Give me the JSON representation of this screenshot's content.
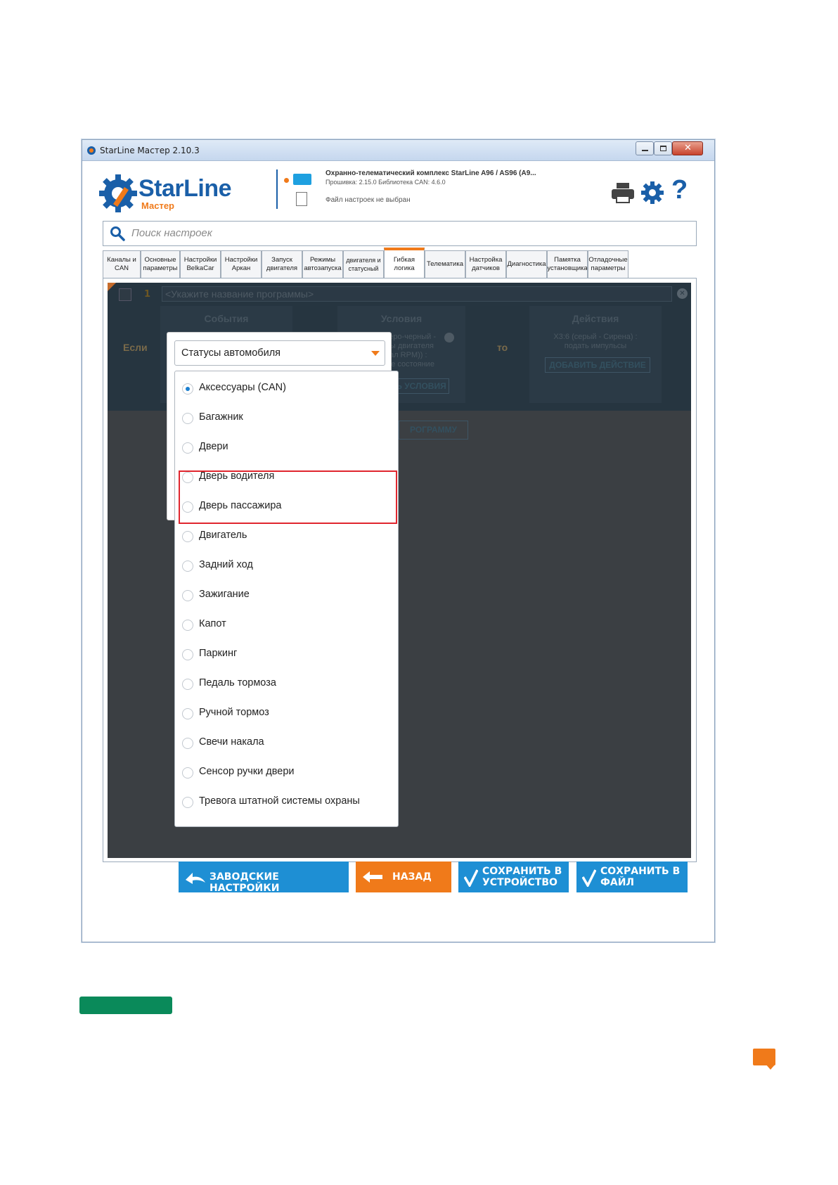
{
  "window": {
    "title": "StarLine Мастер 2.10.3"
  },
  "header": {
    "logo_text": "StarLine",
    "logo_sub": "Мастер",
    "device_title": "Охранно-телематический комплекс StarLine A96 / AS96 (A9...",
    "device_info": "Прошивка: 2.15.0    Библиотека CAN: 4.6.0",
    "file_status": "Файл настроек не выбран",
    "icons": [
      "printer-icon",
      "gear-icon",
      "help-icon"
    ]
  },
  "search": {
    "placeholder": "Поиск настроек"
  },
  "tabs": [
    {
      "label": "Каналы и CAN"
    },
    {
      "label": "Основные параметры"
    },
    {
      "label": "Настройки BelkaCar"
    },
    {
      "label": "Настройки Аркан"
    },
    {
      "label": "Запуск двигателя"
    },
    {
      "label": "Режимы автозапуска"
    },
    {
      "label": "двигателя и статусный"
    },
    {
      "label": "Гибкая логика",
      "active": true
    },
    {
      "label": "Телематика"
    },
    {
      "label": "Настройка датчиков"
    },
    {
      "label": "Диагностика"
    },
    {
      "label": "Памятка установщика"
    },
    {
      "label": "Отладочные параметры"
    }
  ],
  "program": {
    "number": "1",
    "name_placeholder": "<Укажите название программы>",
    "if_label": "Если",
    "then_label": "то",
    "events_title": "События",
    "conditions_title": "Условия",
    "actions_title": "Действия",
    "condition_text": [
      "(серо-черный -",
      "оты двигателя",
      "гнал RPM)) :",
      "ное состояние"
    ],
    "add_condition": "ИТЬ УСЛОВИЯ",
    "action_text": [
      "X3:6 (серый - Сирена) :",
      "подать импульсы"
    ],
    "add_action": "ДОБАВИТЬ ДЕЙСТВИЕ",
    "add_program": "РОГРАММУ"
  },
  "dropdown": {
    "selected": "Статусы автомобиля",
    "options": [
      {
        "label": "Аксессуары (CAN)",
        "checked": true
      },
      {
        "label": "Багажник",
        "checked": false
      },
      {
        "label": "Двери",
        "checked": false
      },
      {
        "label": "Дверь водителя",
        "checked": false
      },
      {
        "label": "Дверь пассажира",
        "checked": false
      },
      {
        "label": "Двигатель",
        "checked": false
      },
      {
        "label": "Задний ход",
        "checked": false
      },
      {
        "label": "Зажигание",
        "checked": false
      },
      {
        "label": "Капот",
        "checked": false
      },
      {
        "label": "Паркинг",
        "checked": false
      },
      {
        "label": "Педаль тормоза",
        "checked": false
      },
      {
        "label": "Ручной тормоз",
        "checked": false
      },
      {
        "label": "Свечи накала",
        "checked": false
      },
      {
        "label": "Сенсор ручки двери",
        "checked": false
      },
      {
        "label": "Тревога штатной системы охраны",
        "checked": false
      }
    ]
  },
  "buttons": {
    "factory": "ЗАВОДСКИЕ НАСТРОЙКИ",
    "back": "НАЗАД",
    "save_device_1": "СОХРАНИТЬ В",
    "save_device_2": "УСТРОЙСТВО",
    "save_file_1": "СОХРАНИТЬ В",
    "save_file_2": "ФАЙЛ"
  },
  "colors": {
    "brand_blue": "#1a5fa8",
    "accent_orange": "#f07a1a",
    "button_blue": "#1e8fd4",
    "highlight_red": "#e0262e",
    "green_bar": "#0a8a5a"
  }
}
